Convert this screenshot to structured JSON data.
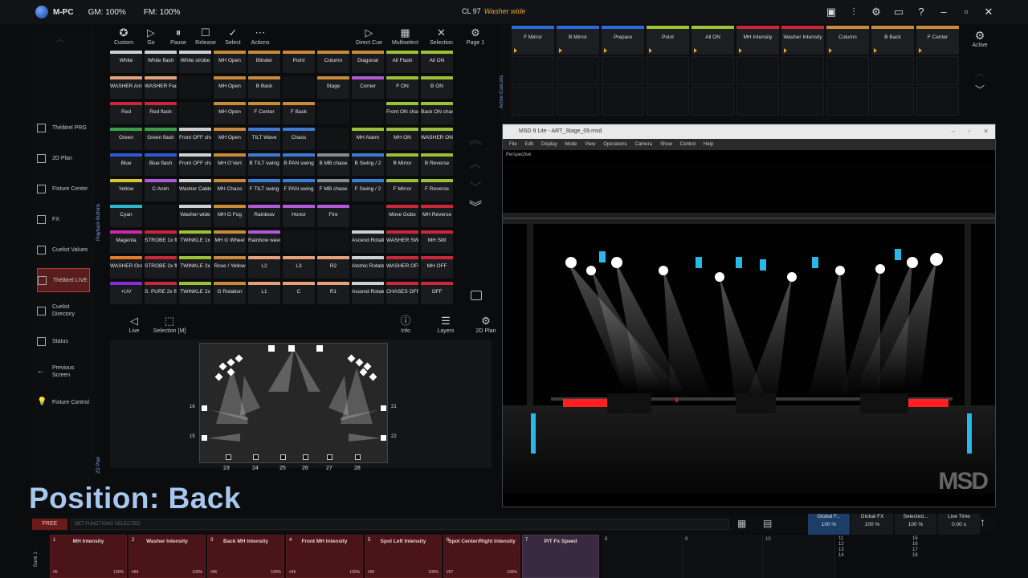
{
  "topbar": {
    "app": "M-PC",
    "gm": "GM: 100%",
    "fm": "FM: 100%",
    "cue_number": "CL 97",
    "cue_name": "Washer wide",
    "icons": [
      "window-icon",
      "sliders-icon",
      "gear-icon",
      "chat-icon",
      "help-icon",
      "minimize-icon",
      "maximize-icon",
      "close-icon"
    ],
    "icon_glyphs": [
      "▣",
      "⫶",
      "⚙",
      "▭",
      "?",
      "–",
      "▫",
      "✕"
    ]
  },
  "sidebar": {
    "items": [
      {
        "label": "Théâtrel PRG",
        "icon": "square-icon"
      },
      {
        "label": "2D Plan",
        "icon": "square-icon"
      },
      {
        "label": "Fixture Center",
        "icon": "square-icon"
      },
      {
        "label": "FX",
        "icon": "square-icon"
      },
      {
        "label": "Cuelist Values",
        "icon": "square-icon"
      },
      {
        "label": "Théâtrel LIVE",
        "icon": "square-icon",
        "active": true
      },
      {
        "label": "Cuelist Directory",
        "icon": "square-icon"
      },
      {
        "label": "Status",
        "icon": "square-icon"
      },
      {
        "label": "Previous Screen",
        "icon": "arrow-left-icon"
      },
      {
        "label": "Fixture Control",
        "icon": "bulb-icon"
      }
    ]
  },
  "playback": {
    "label": "Playback Buttons",
    "page": "Page 1",
    "tools": [
      {
        "label": "Custom",
        "glyph": "✪"
      },
      {
        "label": "Go",
        "glyph": "▷"
      },
      {
        "label": "Pause",
        "glyph": "⏸"
      },
      {
        "label": "Release",
        "glyph": "☐"
      },
      {
        "label": "Select",
        "glyph": "✓"
      },
      {
        "label": "Actions",
        "glyph": "⋯"
      }
    ],
    "tools_right": [
      {
        "label": "Direct Cue",
        "glyph": "▷"
      },
      {
        "label": "Multiselect",
        "glyph": "▦"
      },
      {
        "label": "Selection",
        "glyph": "✕"
      }
    ],
    "grid": [
      [
        {
          "n": "White",
          "c": "#cfcfcf"
        },
        {
          "n": "White flash",
          "c": "#cfcfcf"
        },
        {
          "n": "White strobe",
          "c": "#cfcfcf"
        },
        {
          "n": "MH Open",
          "c": "#c98a3a"
        },
        {
          "n": "Blinder",
          "c": "#c98a3a"
        },
        {
          "n": "Point",
          "c": "#c98a3a"
        },
        {
          "n": "Column",
          "c": "#c98a3a"
        },
        {
          "n": "Diagonal",
          "c": "#c98a3a"
        },
        {
          "n": "All Flash",
          "c": "#9bc235"
        },
        {
          "n": "All ON",
          "c": "#9bc235"
        }
      ],
      [
        {
          "n": "WASHER Amber",
          "c": "#e3a27a"
        },
        {
          "n": "WASHER Fade",
          "c": "#e3a27a"
        },
        null,
        {
          "n": "MH Open",
          "c": "#c98a3a"
        },
        {
          "n": "B Back",
          "c": "#c98a3a"
        },
        null,
        {
          "n": "Stage",
          "c": "#c98a3a"
        },
        {
          "n": "Corner",
          "c": "#b05ad8"
        },
        {
          "n": "F ON",
          "c": "#9bc235"
        },
        {
          "n": "B ON",
          "c": "#9bc235"
        }
      ],
      [
        {
          "n": "Red",
          "c": "#c8283a"
        },
        {
          "n": "Red flash",
          "c": "#c8283a"
        },
        null,
        {
          "n": "MH Open",
          "c": "#c98a3a"
        },
        {
          "n": "F Center",
          "c": "#c98a3a"
        },
        {
          "n": "F Back",
          "c": "#c98a3a"
        },
        null,
        null,
        {
          "n": "Front ON chase",
          "c": "#9bc235"
        },
        {
          "n": "Back ON chase",
          "c": "#9bc235"
        }
      ],
      [
        {
          "n": "Green",
          "c": "#3aa046"
        },
        {
          "n": "Green flash",
          "c": "#3aa046"
        },
        {
          "n": "Front OFF chase",
          "c": "#cfcfcf"
        },
        {
          "n": "MH Open",
          "c": "#c98a3a"
        },
        {
          "n": "TILT Wave",
          "c": "#3a7cd8"
        },
        {
          "n": "Chaos",
          "c": "#3a7cd8"
        },
        null,
        {
          "n": "MH Alarm",
          "c": "#9bc235"
        },
        {
          "n": "MH ON",
          "c": "#9bc235"
        },
        {
          "n": "WASHER ON",
          "c": "#9bc235"
        }
      ],
      [
        {
          "n": "Blue",
          "c": "#2a5ad8"
        },
        {
          "n": "Blue flash",
          "c": "#2a5ad8"
        },
        {
          "n": "Front OFF chase",
          "c": "#cfcfcf"
        },
        {
          "n": "MH G'Vert",
          "c": "#c98a3a"
        },
        {
          "n": "B TILT swing",
          "c": "#3a7cd8"
        },
        {
          "n": "B PAN swing",
          "c": "#3a7cd8"
        },
        {
          "n": "B MB chase",
          "c": "#8a8a8a"
        },
        {
          "n": "B Swing / 2",
          "c": "#3a7cd8"
        },
        {
          "n": "B Mirror",
          "c": "#9bc235"
        },
        {
          "n": "B Reverse",
          "c": "#9bc235"
        }
      ],
      [
        {
          "n": "Yellow",
          "c": "#d8c82a"
        },
        {
          "n": "C Anim",
          "c": "#b05ad8"
        },
        {
          "n": "Washer Cable chase",
          "c": "#cfcfcf"
        },
        {
          "n": "MH Chaos",
          "c": "#c98a3a"
        },
        {
          "n": "F TILT swing",
          "c": "#3a7cd8"
        },
        {
          "n": "F PAN swing",
          "c": "#3a7cd8"
        },
        {
          "n": "F MB chase",
          "c": "#8a8a8a"
        },
        {
          "n": "F Swing / 2",
          "c": "#3a7cd8"
        },
        {
          "n": "F Mirror",
          "c": "#9bc235"
        },
        {
          "n": "F Reverse",
          "c": "#9bc235"
        }
      ],
      [
        {
          "n": "Cyan",
          "c": "#2ab8c8"
        },
        null,
        {
          "n": "Washer wide",
          "c": "#cfcfcf"
        },
        {
          "n": "MH G Fog",
          "c": "#c98a3a"
        },
        {
          "n": "Rainbow",
          "c": "#b05ad8"
        },
        {
          "n": "Honor",
          "c": "#b05ad8"
        },
        {
          "n": "Fire",
          "c": "#b05ad8"
        },
        null,
        {
          "n": "Move Gobo",
          "c": "#c8283a"
        },
        {
          "n": "MH Reverse",
          "c": "#c8283a"
        }
      ],
      [
        {
          "n": "Magenta",
          "c": "#c82aa8"
        },
        {
          "n": "STROBE 1x flash",
          "c": "#c8283a"
        },
        {
          "n": "TWINKLE 1x",
          "c": "#9bc235"
        },
        {
          "n": "MH G Wheel",
          "c": "#c98a3a"
        },
        {
          "n": "Rainbow wave",
          "c": "#b05ad8"
        },
        null,
        null,
        {
          "n": "Ascend Rotation",
          "c": "#cfcfcf"
        },
        {
          "n": "WASHER SW",
          "c": "#c8283a"
        },
        {
          "n": "MH Still",
          "c": "#c8283a"
        }
      ],
      [
        {
          "n": "WASHER Orange",
          "c": "#e37a2a"
        },
        {
          "n": "STROBE 2x flash",
          "c": "#c8283a"
        },
        {
          "n": "TWINKLE 2x",
          "c": "#9bc235"
        },
        {
          "n": "Rose / Yellow",
          "c": "#c98a3a"
        },
        {
          "n": "L2",
          "c": "#e3a27a"
        },
        {
          "n": "L3",
          "c": "#e3a27a"
        },
        {
          "n": "R2",
          "c": "#e3a27a"
        },
        {
          "n": "Atomic Rotate",
          "c": "#cfcfcf"
        },
        {
          "n": "WASHER OFF",
          "c": "#c8283a"
        },
        {
          "n": "MH OFF",
          "c": "#c8283a"
        }
      ],
      [
        {
          "n": "+UV",
          "c": "#8a2ad8"
        },
        {
          "n": "S. PURE 2x flash",
          "c": "#c8283a"
        },
        {
          "n": "TWINKLE 2x",
          "c": "#9bc235"
        },
        {
          "n": "G Rotation",
          "c": "#c98a3a"
        },
        {
          "n": "L1",
          "c": "#e3a27a"
        },
        {
          "n": "C",
          "c": "#e3a27a"
        },
        {
          "n": "R1",
          "c": "#e3a27a"
        },
        {
          "n": "Ascend Rotate",
          "c": "#cfcfcf"
        },
        {
          "n": "CHASES OFF",
          "c": "#c8283a"
        },
        {
          "n": "OFF",
          "c": "#c8283a"
        }
      ]
    ]
  },
  "plan": {
    "label": "2D Plan",
    "tools": [
      {
        "label": "Live",
        "glyph": "◁"
      },
      {
        "label": "Selection [M]",
        "glyph": "⬚"
      }
    ],
    "tools_right": [
      {
        "label": "Info",
        "glyph": "ⓘ"
      },
      {
        "label": "Layers",
        "glyph": "☰"
      },
      {
        "label": "2D Plan",
        "glyph": "⚙"
      }
    ],
    "bottom_numbers": [
      "23",
      "24",
      "25",
      "26",
      "27",
      "28"
    ],
    "side_left": [
      "16",
      "15"
    ],
    "side_right": [
      "21",
      "22"
    ]
  },
  "cuelists": {
    "label": "Active CueLists",
    "active_label": "Active",
    "items": [
      {
        "n": "F Mirror",
        "c": "#2a6ad8"
      },
      {
        "n": "B Mirror",
        "c": "#2a6ad8"
      },
      {
        "n": "Prepare",
        "c": "#2a6ad8"
      },
      {
        "n": "Point",
        "c": "#9bc235"
      },
      {
        "n": "All ON",
        "c": "#9bc235"
      },
      {
        "n": "MH Intensity",
        "c": "#c8283a"
      },
      {
        "n": "Washer Intensity",
        "c": "#c8283a"
      },
      {
        "n": "Column",
        "c": "#c98a3a"
      },
      {
        "n": "B Back",
        "c": "#c98a3a"
      },
      {
        "n": "F Center",
        "c": "#c98a3a"
      }
    ]
  },
  "viz": {
    "title": "MSD 9 Lite - ART_Stage_09.msd",
    "menu": [
      "File",
      "Edit",
      "Display Mode",
      "View",
      "Operations",
      "Camera",
      "Show Control",
      "Help"
    ],
    "view": "Perspective",
    "watermark": "MSD"
  },
  "caption": "Position: Back",
  "command": {
    "free": "FREE",
    "input": "SET FUNCTIONS SELECTED"
  },
  "rates": [
    {
      "label": "Global F...",
      "value": "100 %",
      "sel": true
    },
    {
      "label": "Global FX",
      "value": "100 %"
    },
    {
      "label": "Selected...",
      "value": "100 %"
    },
    {
      "label": "Live Time",
      "value": "0.00 s"
    }
  ],
  "executors": {
    "bank": "Bank 1",
    "items": [
      {
        "num": "1",
        "title": "MH Intensity",
        "cue": "#5",
        "pct": "100%"
      },
      {
        "num": "2",
        "title": "Washer Intensity",
        "cue": "#64",
        "pct": "100%"
      },
      {
        "num": "3",
        "title": "Back MH Intensity",
        "cue": "#66",
        "pct": "100%"
      },
      {
        "num": "4",
        "title": "Front MH Intensity",
        "cue": "#49",
        "pct": "100%"
      },
      {
        "num": "5",
        "title": "Spot Left Intensity",
        "cue": "#50",
        "pct": "100%"
      },
      {
        "num": "6",
        "title": "Spot Center/Right Intensity",
        "cue": "#57",
        "pct": "100%"
      },
      {
        "num": "7",
        "title": "P/T Fx Speed",
        "cue": "",
        "pct": ""
      }
    ],
    "empty": [
      "8",
      "9",
      "10"
    ],
    "list": [
      "11",
      "12",
      "13",
      "14",
      "15",
      "16",
      "17",
      "18"
    ]
  }
}
